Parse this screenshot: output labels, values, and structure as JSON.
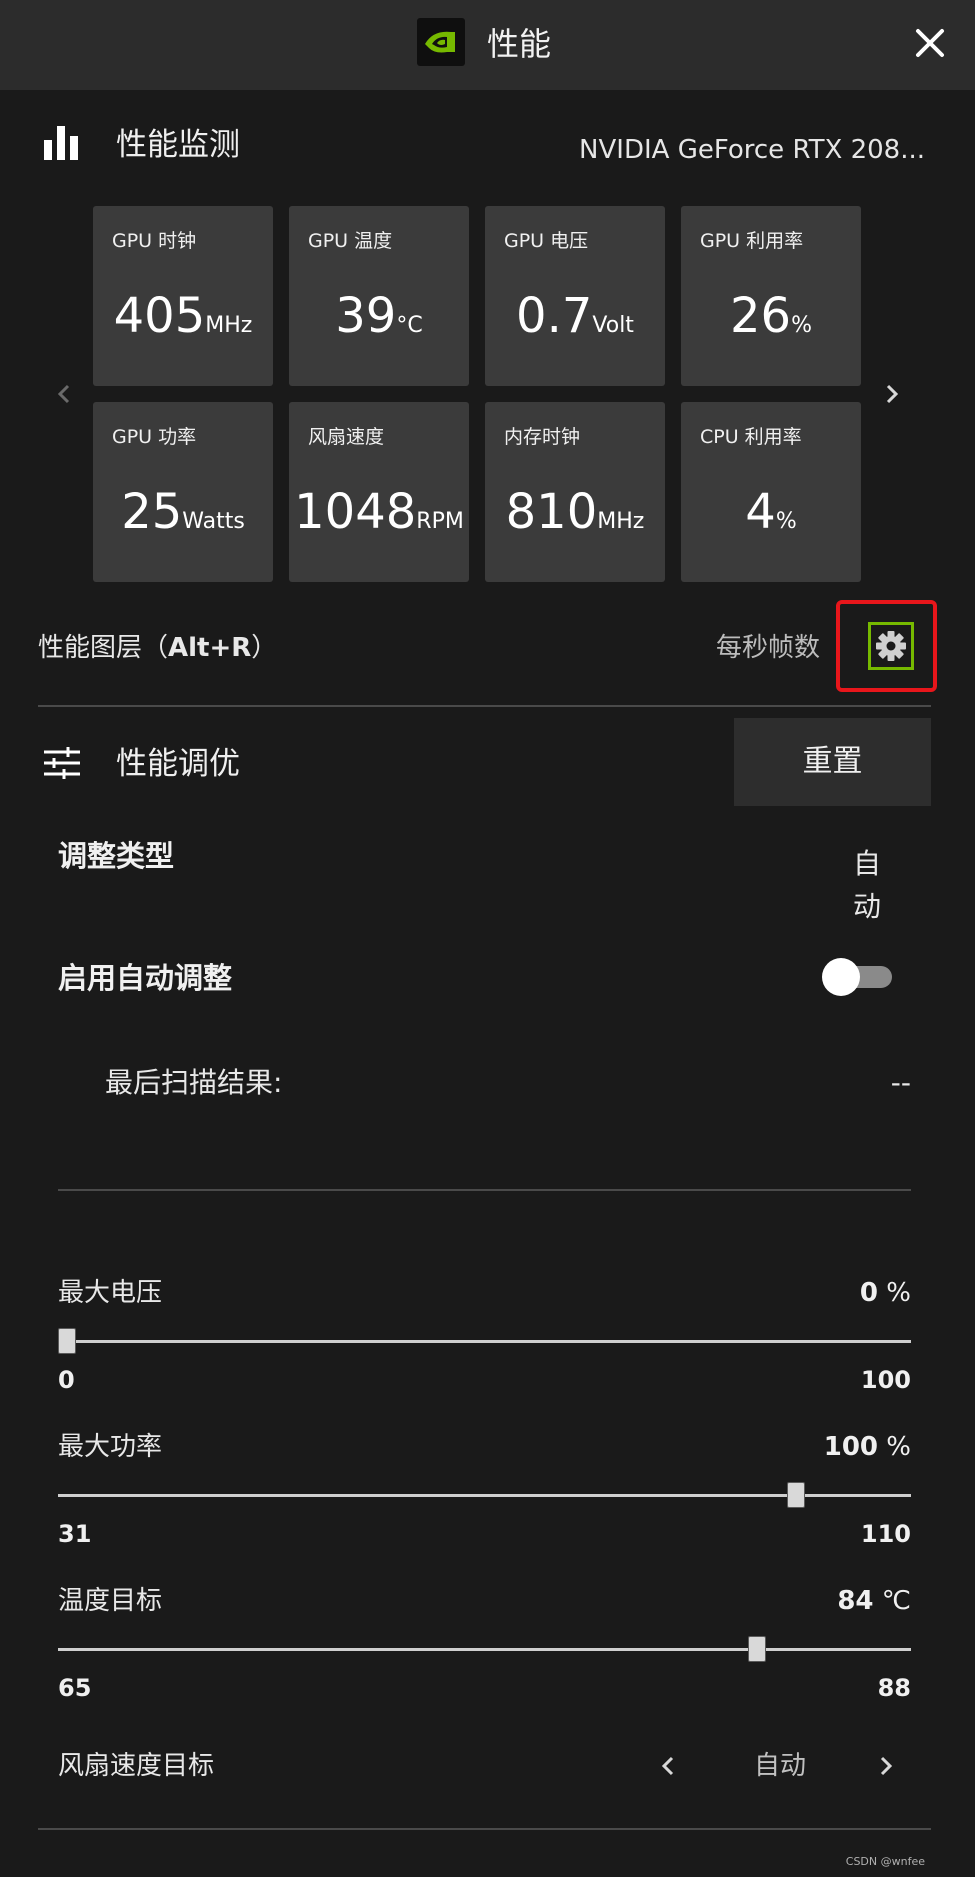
{
  "window": {
    "title": "性能",
    "close_icon": "close-icon"
  },
  "monitor": {
    "section_title": "性能监测",
    "gpu_name": "NVIDIA GeForce RTX 208...",
    "tiles": [
      {
        "label": "GPU 时钟",
        "value": "405",
        "unit": "MHz"
      },
      {
        "label": "GPU 温度",
        "value": "39",
        "unit": "°C"
      },
      {
        "label": "GPU 电压",
        "value": "0.7",
        "unit": "Volt"
      },
      {
        "label": "GPU 利用率",
        "value": "26",
        "unit": "%"
      },
      {
        "label": "GPU 功率",
        "value": "25",
        "unit": "Watts"
      },
      {
        "label": "风扇速度",
        "value": "1048",
        "unit": "RPM"
      },
      {
        "label": "内存时钟",
        "value": "810",
        "unit": "MHz"
      },
      {
        "label": "CPU 利用率",
        "value": "4",
        "unit": "%"
      }
    ]
  },
  "overlay": {
    "label_prefix": "性能图层（",
    "label_hotkey": "Alt+R",
    "label_suffix": "）",
    "fps_label": "每秒帧数"
  },
  "tuning": {
    "section_title": "性能调优",
    "reset_label": "重置",
    "adjust_type_label": "调整类型",
    "adjust_type_value": "自动",
    "auto_tune_label": "启用自动调整",
    "auto_tune_enabled": false,
    "last_scan_label": "最后扫描结果:",
    "last_scan_value": "--"
  },
  "sliders": {
    "voltage": {
      "label": "最大电压",
      "value": "0",
      "unit": " %",
      "min": "0",
      "max": "100",
      "fraction": 0.0
    },
    "power": {
      "label": "最大功率",
      "value": "100",
      "unit": " %",
      "min": "31",
      "max": "110",
      "fraction": 0.873
    },
    "temp": {
      "label": "温度目标",
      "value": "84",
      "unit": " ℃",
      "min": "65",
      "max": "88",
      "fraction": 0.826
    }
  },
  "fan_target": {
    "label": "风扇速度目标",
    "value": "自动"
  },
  "watermark": "CSDN @wnfee",
  "colors": {
    "accent": "#76b900",
    "highlight": "#e8161b",
    "background": "#1a1a1a",
    "tile": "#3b3b3b"
  }
}
